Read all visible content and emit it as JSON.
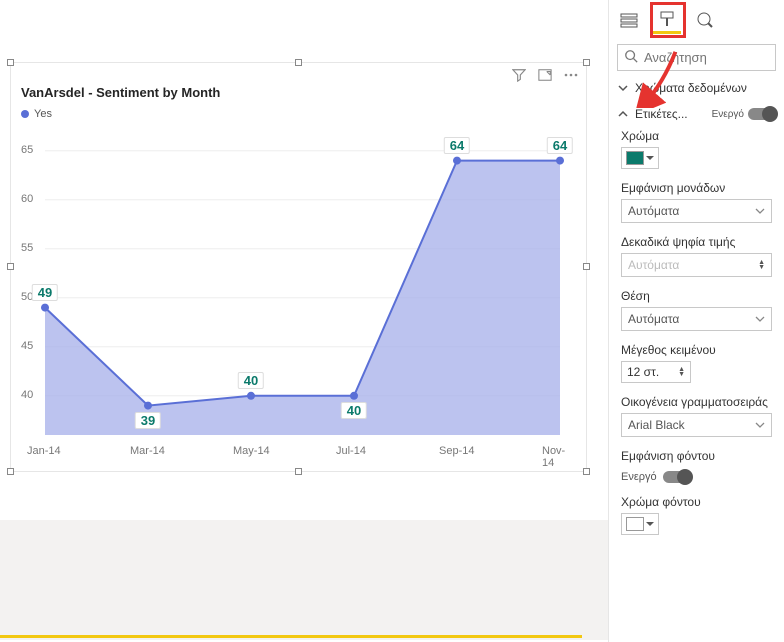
{
  "chart_data": {
    "type": "area",
    "title": "VanArsdel - Sentiment by Month",
    "legend": [
      "Yes"
    ],
    "categories": [
      "Jan-14",
      "Mar-14",
      "May-14",
      "Jul-14",
      "Sep-14",
      "Nov-14"
    ],
    "values": [
      49,
      39,
      40,
      40,
      64,
      64
    ],
    "y_ticks": [
      40,
      45,
      50,
      55,
      60,
      65
    ],
    "ylim": [
      36,
      66
    ],
    "series_color": "#a6afea",
    "line_color": "#5a6fd6",
    "label_color": "#0b7a6b"
  },
  "header": {
    "title": "VanArsdel - Sentiment by Month"
  },
  "panel": {
    "search_placeholder": "Αναζήτηση",
    "section_data_colors": "Χρώματα δεδομένων",
    "section_labels": "Ετικέτες...",
    "toggle_on": "Ενεργό",
    "color_label": "Χρώμα",
    "color_value": "#0b7a6b",
    "units_label": "Εμφάνιση μονάδων",
    "units_value": "Αυτόματα",
    "decimals_label": "Δεκαδικά ψηφία τιμής",
    "decimals_value": "Αυτόματα",
    "position_label": "Θέση",
    "position_value": "Αυτόματα",
    "textsize_label": "Μέγεθος κειμένου",
    "textsize_value": "12 στ.",
    "font_label": "Οικογένεια γραμματοσειράς",
    "font_value": "Arial Black",
    "bg_show_label": "Εμφάνιση φόντου",
    "bg_on": "Ενεργό",
    "bg_color_label": "Χρώμα φόντου",
    "bg_color_value": "#ffffff"
  }
}
